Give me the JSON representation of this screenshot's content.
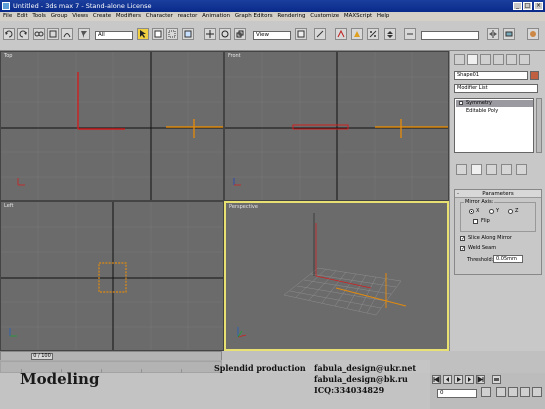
{
  "window": {
    "title": "Untitled - 3ds max 7 - Stand-alone License",
    "controls": [
      "_",
      "□",
      "×"
    ]
  },
  "menu": [
    "File",
    "Edit",
    "Tools",
    "Group",
    "Views",
    "Create",
    "Modifiers",
    "Character",
    "reactor",
    "Animation",
    "Graph Editors",
    "Rendering",
    "Customize",
    "MAXScript",
    "Help"
  ],
  "toolbar": {
    "selection_filter": "All",
    "ref_coord": "View",
    "named_sets": ""
  },
  "viewports": {
    "top_label": "Top",
    "front_label": "Front",
    "left_label": "Left",
    "perspective_label": "Perspective"
  },
  "command_panel": {
    "object_name": "Shape01",
    "modifier_list": "Modifier List",
    "stack": [
      "Symmetry",
      "Editable Poly"
    ],
    "rollout_title": "Parameters",
    "rollout_sign": "-",
    "mirror_axis_title": "Mirror Axis:",
    "axes": [
      "X",
      "Y",
      "Z"
    ],
    "flip_label": "Flip",
    "slice_label": "Slice Along Mirror",
    "weld_label": "Weld Seam",
    "threshold_label": "Threshold:",
    "threshold_value": "0.05mm"
  },
  "timeline": {
    "slider_text": "0 / 100"
  },
  "overlay": {
    "title": "Modeling",
    "credit_left": [
      "Splendid production"
    ],
    "credit_right": [
      "fabula_design@ukr.net",
      "fabula_design@bk.ru",
      "ICQ:334034829"
    ]
  },
  "status": {
    "frame_value": "0"
  }
}
